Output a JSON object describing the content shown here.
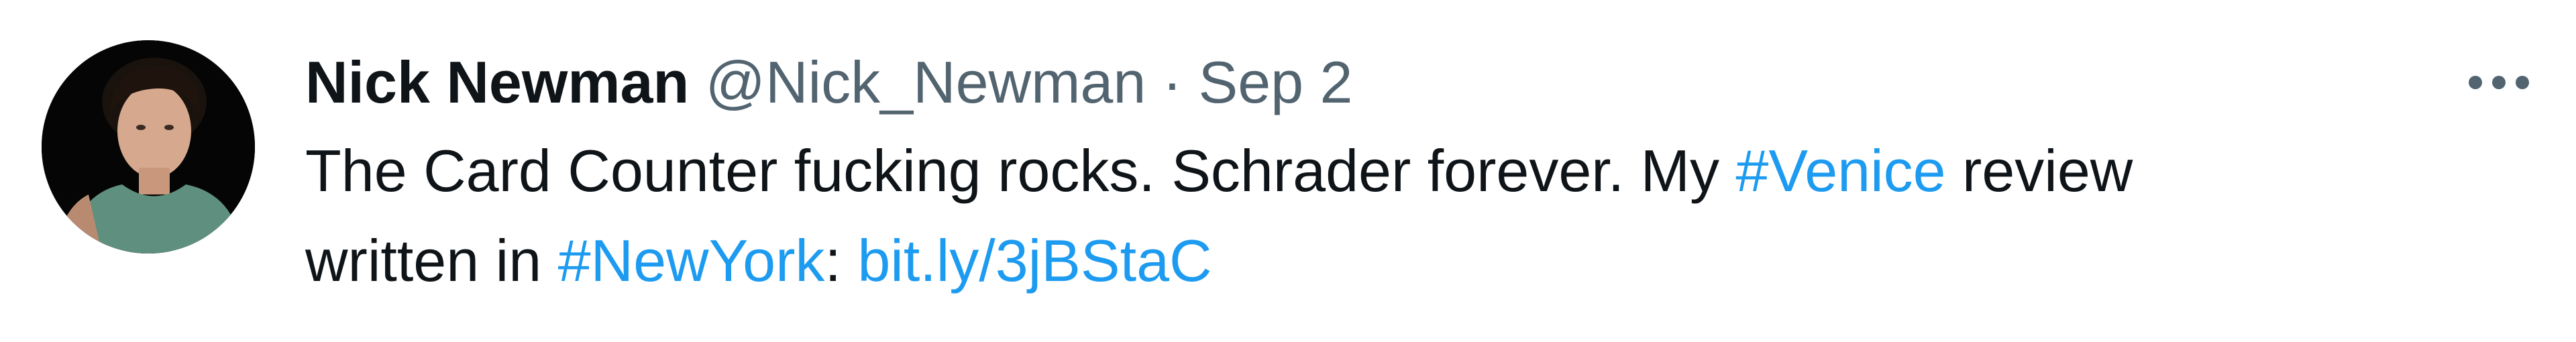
{
  "tweet": {
    "author_name": "Nick Newman",
    "handle": "@Nick_Newman",
    "separator": "·",
    "date": "Sep 2",
    "text_part1": "The Card Counter fucking rocks. Schrader forever. My ",
    "hashtag1": "#Venice",
    "text_part2": " review",
    "text_part3": "written in ",
    "hashtag2": "#NewYork",
    "text_part4": ": ",
    "link": "bit.ly/3jBStaC",
    "more_icon": "more-horizontal-icon",
    "avatar_icon": "user-avatar"
  },
  "colors": {
    "link": "#1d9bf0",
    "text_primary": "#0f1419",
    "text_secondary": "#536471"
  }
}
